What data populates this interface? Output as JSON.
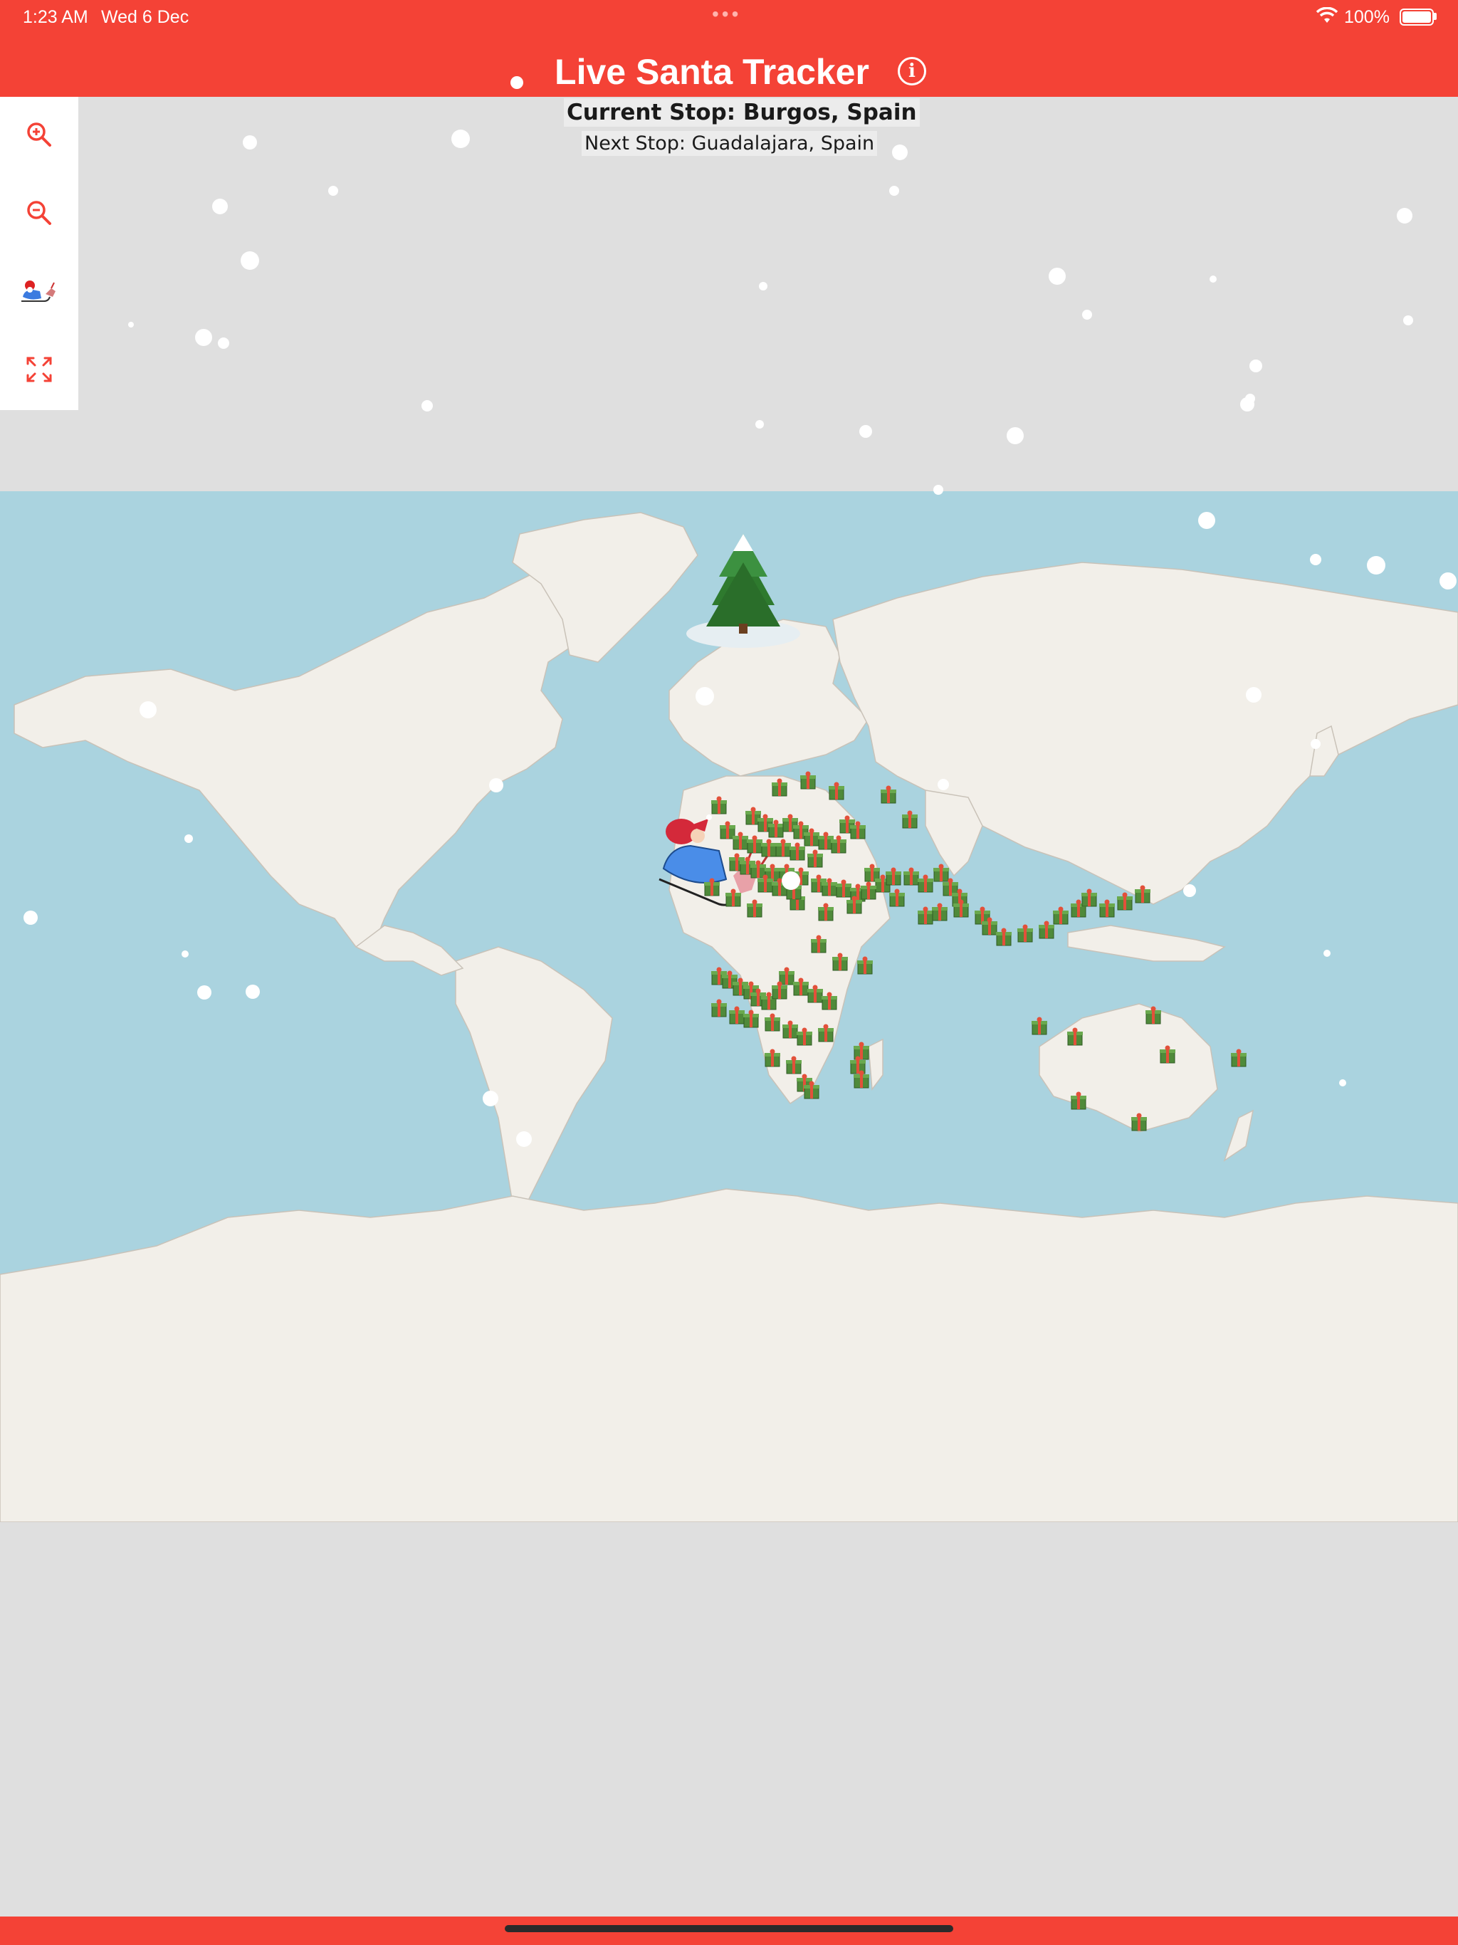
{
  "status_bar": {
    "time": "1:23 AM",
    "date": "Wed 6 Dec",
    "battery": "100%"
  },
  "header": {
    "title": "Live Santa Tracker",
    "info_icon": "info-circle-icon"
  },
  "stops": {
    "current": "Current Stop: Burgos, Spain",
    "next": "Next Stop: Guadalajara, Spain"
  },
  "controls": [
    {
      "name": "zoom-in-button",
      "icon": "zoom-in-icon"
    },
    {
      "name": "zoom-out-button",
      "icon": "zoom-out-icon"
    },
    {
      "name": "center-on-santa-button",
      "icon": "santa-sleigh-icon"
    },
    {
      "name": "fullscreen-button",
      "icon": "expand-icon"
    }
  ],
  "map": {
    "markers": [
      "santa-sleigh",
      "christmas-tree-north-pole",
      "gift-markers"
    ],
    "colors": {
      "ocean": "#aad3df",
      "land": "#f2efe9",
      "accent": "#f44236",
      "gift_box": "#4f8a3a",
      "gift_ribbon": "#e2513a"
    }
  }
}
